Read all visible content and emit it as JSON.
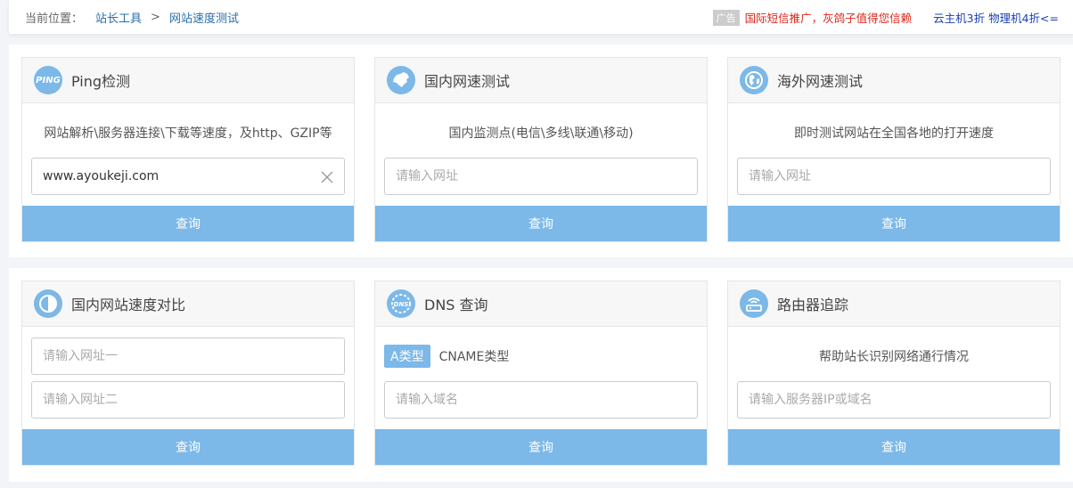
{
  "breadcrumb": {
    "label": "当前位置：",
    "items": [
      "站长工具",
      "网站速度测试"
    ],
    "separator": ">"
  },
  "ads": {
    "tag": "广告",
    "red_link": "国际短信推广，灰鸽子值得您信赖",
    "blue_link": "云主机3折 物理机4折<="
  },
  "cards": [
    {
      "title": "Ping检测",
      "icon": "ping-icon",
      "icon_text": "PING",
      "description": "网站解析\\服务器连接\\下载等速度，及http、GZIP等",
      "input_value": "www.ayoukeji.com",
      "button": "查询"
    },
    {
      "title": "国内网速测试",
      "icon": "china-map-icon",
      "description": "国内监测点(电信\\多线\\联通\\移动)",
      "input_placeholder": "请输入网址",
      "button": "查询"
    },
    {
      "title": "海外网速测试",
      "icon": "globe-icon",
      "description": "即时测试网站在全国各地的打开速度",
      "input_placeholder": "请输入网址",
      "button": "查询"
    },
    {
      "title": "国内网站速度对比",
      "icon": "half-circle-icon",
      "input_placeholder_1": "请输入网址一",
      "input_placeholder_2": "请输入网址二",
      "button": "查询"
    },
    {
      "title": "DNS 查询",
      "icon": "dns-icon",
      "icon_text": "DNS",
      "type_active": "A类型",
      "type_other": "CNAME类型",
      "input_placeholder": "请输入域名",
      "button": "查询"
    },
    {
      "title": "路由器追踪",
      "icon": "router-icon",
      "description": "帮助站长识别网络通行情况",
      "input_placeholder": "请输入服务器IP或域名",
      "button": "查询"
    }
  ],
  "colors": {
    "accent": "#7cb8e8",
    "link": "#2b6fa8",
    "ad_red": "#d9261c",
    "ad_blue": "#1c3fb3"
  }
}
